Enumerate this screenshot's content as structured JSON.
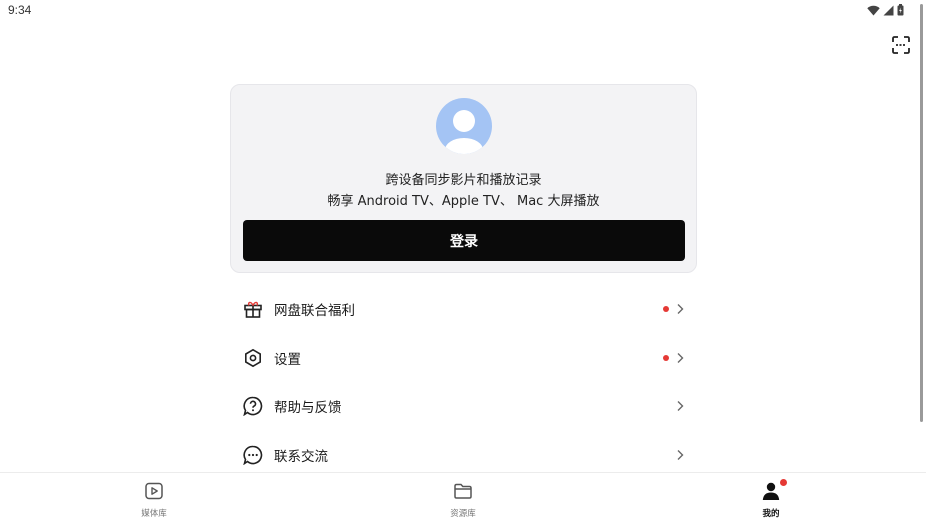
{
  "status_bar": {
    "time": "9:34",
    "icons": [
      "wifi-icon",
      "signal-icon",
      "battery-icon"
    ]
  },
  "header": {
    "scan_icon": "scan-icon"
  },
  "login_card": {
    "avatar_icon": "user-avatar-icon",
    "line1": "跨设备同步影片和播放记录",
    "line2": "畅享 Android TV、Apple TV、 Mac 大屏播放",
    "login_label": "登录"
  },
  "menu": {
    "items": [
      {
        "label": "网盘联合福利",
        "icon": "gift-icon",
        "has_dot": true
      },
      {
        "label": "设置",
        "icon": "settings-hex-icon",
        "has_dot": true
      },
      {
        "label": "帮助与反馈",
        "icon": "help-icon",
        "has_dot": false
      },
      {
        "label": "联系交流",
        "icon": "chat-icon",
        "has_dot": false
      }
    ]
  },
  "tab_bar": {
    "tabs": [
      {
        "label": "媒体库",
        "icon": "play-square-icon",
        "active": false
      },
      {
        "label": "资源库",
        "icon": "folder-icon",
        "active": false
      },
      {
        "label": "我的",
        "icon": "person-icon",
        "active": true,
        "badge": true
      }
    ]
  },
  "colors": {
    "accent_red": "#e53935",
    "card_bg": "#f3f3f5",
    "button_bg": "#0a0a0a",
    "avatar_bg": "#a4c4f4"
  }
}
